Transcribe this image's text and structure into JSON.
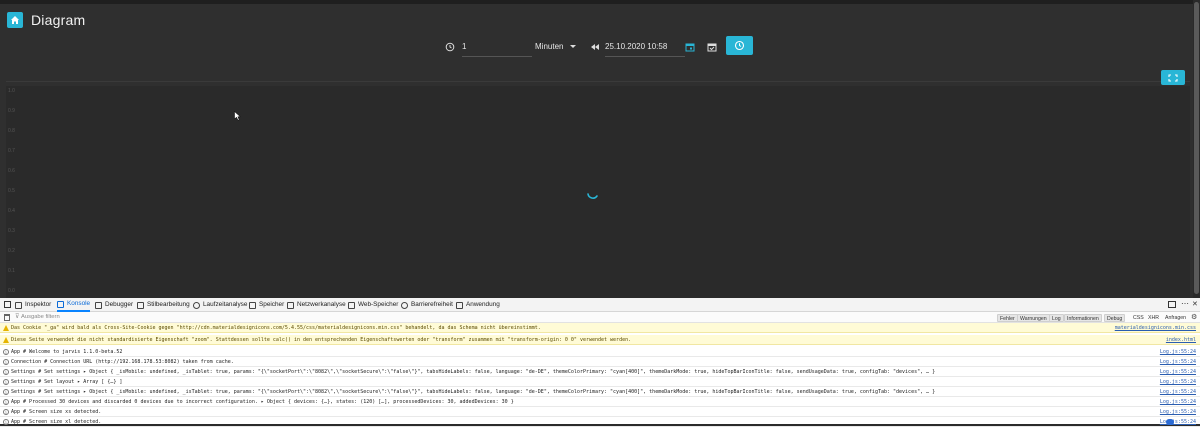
{
  "app": {
    "title": "Diagram",
    "accent": "#29b6d6",
    "toolbar": {
      "range_value": "1",
      "unit": "Minuten",
      "datetime": "25.10.2020 10:58"
    },
    "chart": {
      "yticks": [
        "1.0",
        "0.9",
        "0.8",
        "0.7",
        "0.6",
        "0.5",
        "0.4",
        "0.3",
        "0.2",
        "0.1",
        "0.0"
      ]
    }
  },
  "devtools": {
    "tabs": [
      "Inspektor",
      "Konsole",
      "Debugger",
      "Stilbearbeitung",
      "Laufzeitanalyse",
      "Speicher",
      "Netzwerkanalyse",
      "Web-Speicher",
      "Barrierefreiheit",
      "Anwendung"
    ],
    "filter_placeholder": "Ausgabe filtern",
    "filters": [
      "Fehler",
      "Warnungen",
      "Log",
      "Informationen",
      "Debug",
      "CSS",
      "XHR",
      "Anfragen"
    ],
    "messages": [
      {
        "level": "warn",
        "text": "Das Cookie \"_ga\" wird bald als Cross-Site-Cookie gegen \"http://cdn.materialdesignicons.com/5.4.55/css/materialdesignicons.min.css\" behandelt, da das Schema nicht übereinstimmt.",
        "source": "materialdesignicons.min.css"
      },
      {
        "level": "warn",
        "text": "Diese Seite verwendet die nicht standardisierte Eigenschaft \"zoom\". Stattdessen sollte calc() in den entsprechenden Eigenschaftswerten oder \"transform\" zusammen mit \"transform-origin: 0 0\" verwendet werden.",
        "source": "index.html"
      },
      {
        "level": "info",
        "text": "App # Welcome to jarvis 1.1.0-beta.52",
        "source": "Log.js:55:24"
      },
      {
        "level": "info",
        "text": "Connection # Connection URL (http://192.168.178.53:8082) taken from cache.",
        "source": "Log.js:55:24"
      },
      {
        "level": "info",
        "text": "Settings # Set settings ▸ Object { _isMobile: undefined, _isTablet: true, params: \"{\\\"socketPort\\\":\\\"8082\\\",\\\"socketSecure\\\":\\\"false\\\"}\", tabsHideLabels: false, language: \"de-DE\", themeColorPrimary: \"cyan[400]\", themeDarkMode: true, hideTopBarIconTitle: false, sendUsageData: true, configTab: \"devices\", … }",
        "source": "Log.js:55:24"
      },
      {
        "level": "info",
        "text": "Settings # Set layout ▸ Array [ {…} ]",
        "source": "Log.js:55:24"
      },
      {
        "level": "info",
        "text": "Settings # Set settings ▸ Object { _isMobile: undefined, _isTablet: true, params: \"{\\\"socketPort\\\":\\\"8082\\\",\\\"socketSecure\\\":\\\"false\\\"}\", tabsHideLabels: false, language: \"de-DE\", themeColorPrimary: \"cyan[400]\", themeDarkMode: true, hideTopBarIconTitle: false, sendUsageData: true, configTab: \"devices\", … }",
        "source": "Log.js:55:24"
      },
      {
        "level": "info",
        "text": "App # Processed 30 devices and discarded 0 devices due to incorrect configuration. ▸ Object { devices: {…}, states: (120) […], processedDevices: 30, addedDevices: 30 }",
        "source": "Log.js:55:24"
      },
      {
        "level": "info",
        "text": "App # Screen size xs detected.",
        "source": "Log.js:55:24"
      },
      {
        "level": "info",
        "text": "App # Screen size xl detected.",
        "source": "Log.js:55:24"
      }
    ]
  }
}
